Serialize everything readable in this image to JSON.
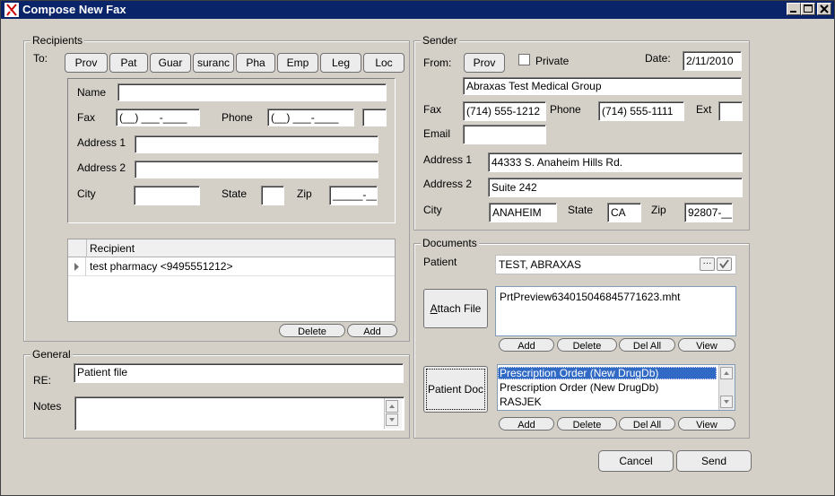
{
  "window": {
    "title": "Compose New Fax",
    "controls": [
      "minimize-icon",
      "maximize-icon",
      "close-icon"
    ]
  },
  "recipients": {
    "group_label": "Recipients",
    "to_label": "To:",
    "to_buttons": [
      "Prov",
      "Pat",
      "Guar",
      "suranc",
      "Pha",
      "Emp",
      "Leg",
      "Loc"
    ],
    "name_label": "Name",
    "name_value": "",
    "fax_label": "Fax",
    "fax_value": "(__) ___-____",
    "phone_label": "Phone",
    "phone_value": "(__) ___-____",
    "ext_value": "",
    "address1_label": "Address 1",
    "address1_value": "",
    "address2_label": "Address 2",
    "address2_value": "",
    "city_label": "City",
    "city_value": "",
    "state_label": "State",
    "state_value": "",
    "zip_label": "Zip",
    "zip_value": "_____-____",
    "grid_header": "Recipient",
    "grid_rows": [
      "test pharmacy <9495551212>"
    ],
    "delete_label": "Delete",
    "add_label": "Add"
  },
  "general": {
    "group_label": "General",
    "re_label": "RE:",
    "re_value": "Patient file",
    "notes_label": "Notes",
    "notes_value": ""
  },
  "sender": {
    "group_label": "Sender",
    "from_label": "From:",
    "prov_label": "Prov",
    "private_label": "Private",
    "private_checked": false,
    "date_label": "Date:",
    "date_value": "2/11/2010",
    "org_value": "Abraxas Test Medical Group",
    "fax_label": "Fax",
    "fax_value": "(714) 555-1212",
    "phone_label": "Phone",
    "phone_value": "(714) 555-1111",
    "ext_label": "Ext",
    "ext_value": "",
    "email_label": "Email",
    "email_value": "",
    "address1_label": "Address 1",
    "address1_value": "44333 S. Anaheim Hills Rd.",
    "address2_label": "Address 2",
    "address2_value": "Suite 242",
    "city_label": "City",
    "city_value": "ANAHEIM",
    "state_label": "State",
    "state_value": "CA",
    "zip_label": "Zip",
    "zip_value": "92807-__"
  },
  "documents": {
    "group_label": "Documents",
    "patient_label": "Patient",
    "patient_value": "TEST, ABRAXAS",
    "attach_label_prefix": "A",
    "attach_label_rest": "ttach File",
    "attached_files": [
      "PrtPreview634015046845771623.mht"
    ],
    "patient_doc_label": "Patient Doc",
    "patient_docs": [
      "Prescription Order (New DrugDb)",
      "Prescription Order (New DrugDb)",
      "RASJEK"
    ],
    "patient_docs_selected": 0,
    "add_label": "Add",
    "delete_label": "Delete",
    "del_all_label": "Del All",
    "view_label": "View"
  },
  "footer": {
    "cancel_label": "Cancel",
    "send_label": "Send"
  }
}
